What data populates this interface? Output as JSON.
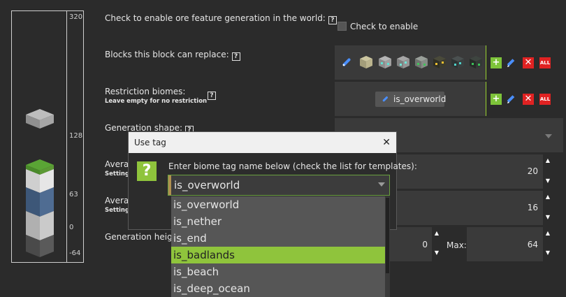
{
  "preview": {
    "ticks": [
      "320",
      "128",
      "63",
      "0",
      "-64"
    ]
  },
  "rows": {
    "enable_label": "Check to enable ore feature generation in the world:",
    "enable_checkbox_label": "Check to enable",
    "replace_label": "Blocks this block can replace:",
    "biomes_label": "Restriction biomes:",
    "biomes_sub": "Leave empty for no restriction",
    "biome_chip": "is_overworld",
    "shape_label": "Generation shape:",
    "avg1_label": "Averag",
    "avg1_sub": "Setting",
    "avg1_value": "20",
    "avg2_label": "Averag",
    "avg2_sub": "Setting",
    "avg2_value": "16",
    "height_label": "Generation height",
    "min_value": "0",
    "max_label": "Max:",
    "max_value": "64",
    "help_glyph": "?"
  },
  "buttons": {
    "add": "+",
    "delete": "✕",
    "delete_all": "ALL"
  },
  "dialog": {
    "title": "Use tag",
    "close": "✕",
    "icon": "?",
    "message": "Enter biome tag name below (check the list for templates):",
    "input_value": "is_overworld",
    "options": [
      "is_overworld",
      "is_nether",
      "is_end",
      "is_badlands",
      "is_beach",
      "is_deep_ocean"
    ],
    "selected_index": 3
  },
  "colors": {
    "accent_green": "#8fc43c",
    "delete_red": "#e02222",
    "background": "#2b2b2b",
    "panel": "#3a3a3a"
  },
  "icons": [
    "help-icon",
    "tag-icon",
    "add-icon",
    "edit-icon",
    "delete-icon",
    "delete-all-icon",
    "close-icon",
    "question-icon",
    "chevron-down-icon",
    "spin-up-icon",
    "spin-down-icon"
  ]
}
